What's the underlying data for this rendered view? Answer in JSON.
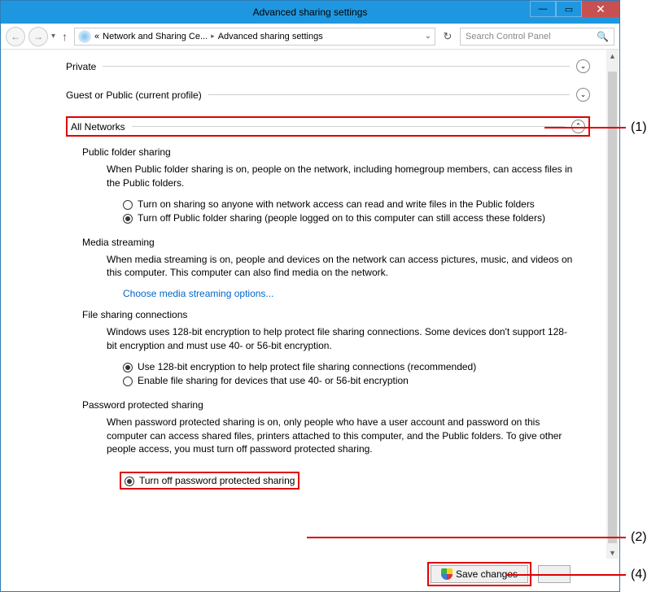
{
  "window": {
    "title": "Advanced sharing settings"
  },
  "nav": {
    "breadcrumb_prefix": "«",
    "breadcrumb_parent": "Network and Sharing Ce...",
    "breadcrumb_current": "Advanced sharing settings",
    "search_placeholder": "Search Control Panel"
  },
  "sections": {
    "private": "Private",
    "guest": "Guest or Public (current profile)",
    "all_networks": "All Networks"
  },
  "public_folder": {
    "heading": "Public folder sharing",
    "desc": "When Public folder sharing is on, people on the network, including homegroup members, can access files in the Public folders.",
    "opt_on": "Turn on sharing so anyone with network access can read and write files in the Public folders",
    "opt_off": "Turn off Public folder sharing (people logged on to this computer can still access these folders)"
  },
  "media": {
    "heading": "Media streaming",
    "desc": "When media streaming is on, people and devices on the network can access pictures, music, and videos on this computer. This computer can also find media on the network.",
    "link": "Choose media streaming options..."
  },
  "file_sharing": {
    "heading": "File sharing connections",
    "desc": "Windows uses 128-bit encryption to help protect file sharing connections. Some devices don't support 128-bit encryption and must use 40- or 56-bit encryption.",
    "opt_128": "Use 128-bit encryption to help protect file sharing connections (recommended)",
    "opt_40": "Enable file sharing for devices that use 40- or 56-bit encryption"
  },
  "password": {
    "heading": "Password protected sharing",
    "desc": "When password protected sharing is on, only people who have a user account and password on this computer can access shared files, printers attached to this computer, and the Public folders. To give other people access, you must turn off password protected sharing.",
    "opt_off": "Turn off password protected sharing"
  },
  "footer": {
    "save": "Save changes"
  },
  "callouts": {
    "c1": "(1)",
    "c2": "(2)",
    "c4": "(4)"
  }
}
